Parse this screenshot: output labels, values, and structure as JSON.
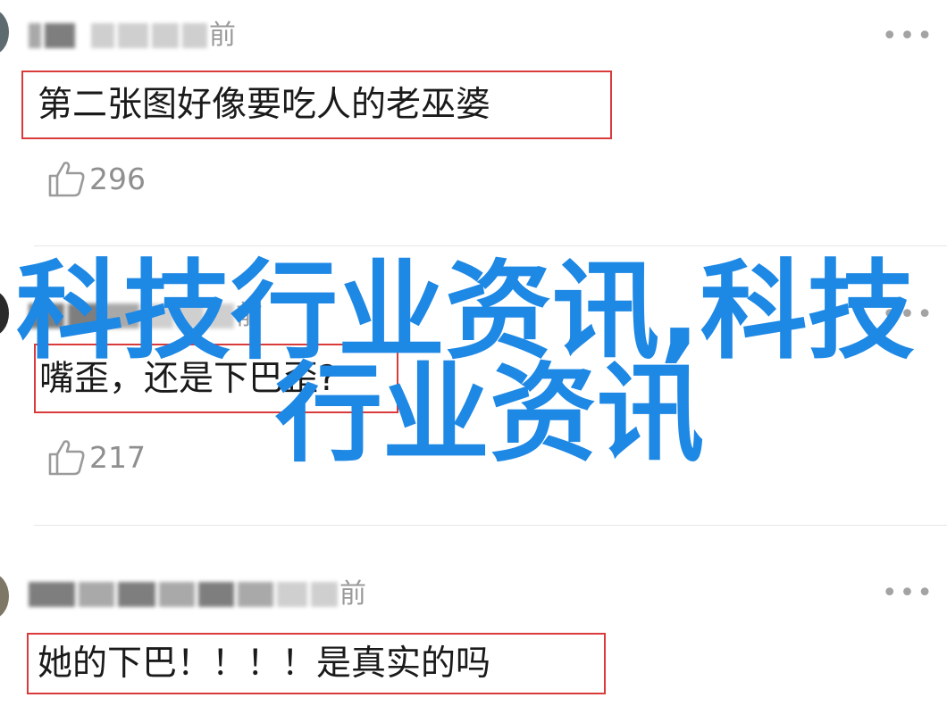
{
  "comments": [
    {
      "time_suffix": "前",
      "text": "第二张图好像要吃人的老巫婆",
      "likes": "296",
      "more": "•••"
    },
    {
      "time_suffix": "前",
      "text": "嘴歪，还是下巴歪?",
      "likes": "217",
      "more": "•••"
    },
    {
      "time_suffix": "前",
      "text": "她的下巴！！！！是真实的吗",
      "more": "•••"
    }
  ],
  "watermark": {
    "line1": "科技行业资讯,科技",
    "line2": "行业资讯"
  },
  "colors": {
    "highlight_border": "#d93b3b",
    "watermark": "#1e88e5",
    "meta_gray": "#9a9a9a"
  },
  "icons": {
    "like": "thumbs-up-icon",
    "more": "more-dots-icon"
  }
}
